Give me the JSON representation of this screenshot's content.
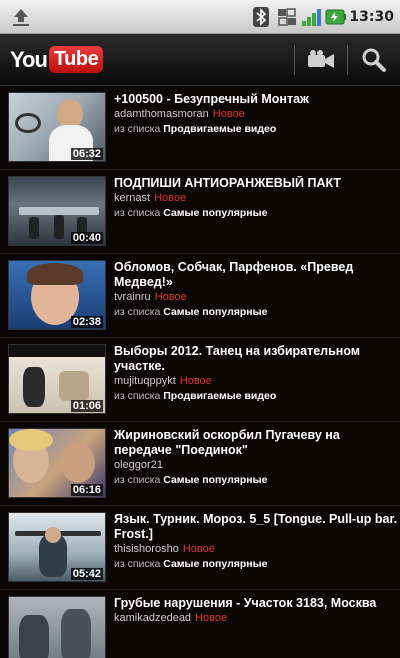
{
  "status": {
    "time": "13:30"
  },
  "header": {
    "logo_you": "You",
    "logo_tube": "Tube"
  },
  "videos": [
    {
      "title": "+100500 - Безупречный Монтаж",
      "author": "adamthomasmoran",
      "badge": "Новое",
      "source_prefix": "из списка",
      "source_list": "Продвигаемые видео",
      "duration": "06:32"
    },
    {
      "title": "ПОДПИШИ АНТИОРАНЖЕВЫЙ ПАКТ",
      "author": "kernast",
      "badge": "Новое",
      "source_prefix": "из списка",
      "source_list": "Самые популярные",
      "duration": "00:40"
    },
    {
      "title": "Обломов, Собчак, Парфенов. «Превед Медвед!»",
      "author": "tvrainru",
      "badge": "Новое",
      "source_prefix": "из списка",
      "source_list": "Самые популярные",
      "duration": "02:38"
    },
    {
      "title": "Выборы 2012. Танец на избирательном участке.",
      "author": "mujituqppykt",
      "badge": "Новое",
      "source_prefix": "из списка",
      "source_list": "Продвигаемые видео",
      "duration": "01:06"
    },
    {
      "title": "Жириновский оскорбил Пугачеву на передаче \"Поединок\"",
      "author": "oleggor21",
      "badge": "",
      "source_prefix": "из списка",
      "source_list": "Самые популярные",
      "duration": "06:16"
    },
    {
      "title": "Язык. Турник. Мороз. 5_5 [Tongue. Pull-up bar. Frost.]",
      "author": "thisishorosho",
      "badge": "Новое",
      "source_prefix": "из списка",
      "source_list": "Самые популярные",
      "duration": "05:42"
    },
    {
      "title": "Грубые нарушения - Участок 3183, Москва",
      "author": "kamikadzedead",
      "badge": "Новое",
      "source_prefix": "",
      "source_list": "",
      "duration": ""
    }
  ],
  "colors": {
    "badge": "#e0312c",
    "logo_red": "#d41f1f",
    "signal_green": "#3ea83e"
  }
}
